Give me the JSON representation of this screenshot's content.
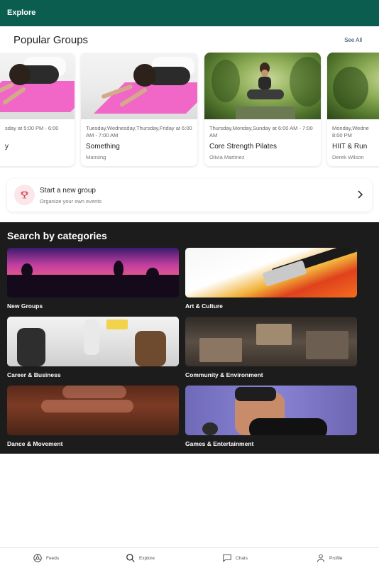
{
  "header": {
    "title": "Explore"
  },
  "popular": {
    "title": "Popular Groups",
    "see_all": "See All",
    "cards": [
      {
        "schedule": "sday at 5:00 PM - 6:00",
        "name": "y",
        "host": ""
      },
      {
        "schedule": "Tuesday,Wednesday,Thursday,Friday at 6:00 AM - 7:00 AM",
        "name": "Something",
        "host": "Mansing"
      },
      {
        "schedule": "Thursday,Monday,Sunday at 6:00 AM - 7:00 AM",
        "name": "Core Strength Pilates",
        "host": "Olivia Martinez"
      },
      {
        "schedule": "Monday,Wedne 8:00 PM",
        "name": "HIIT & Run",
        "host": "Derek Wilson"
      }
    ]
  },
  "new_group": {
    "title": "Start a new group",
    "subtitle": "Organize your own events"
  },
  "categories": {
    "title": "Search by categories",
    "items": [
      {
        "label": "New Groups"
      },
      {
        "label": "Art & Culture"
      },
      {
        "label": "Career & Business"
      },
      {
        "label": "Community & Environment"
      },
      {
        "label": "Dance & Movement"
      },
      {
        "label": "Games & Entertainment"
      }
    ]
  },
  "nav": {
    "items": [
      {
        "label": "Feeds",
        "icon": "feeds-icon"
      },
      {
        "label": "Explore",
        "icon": "search-icon"
      },
      {
        "label": "Chats",
        "icon": "chat-icon"
      },
      {
        "label": "Profile",
        "icon": "profile-icon"
      }
    ]
  },
  "colors": {
    "header": "#0b5d4f",
    "categories_bg": "#1c1c1c",
    "accent": "#d23b53"
  }
}
